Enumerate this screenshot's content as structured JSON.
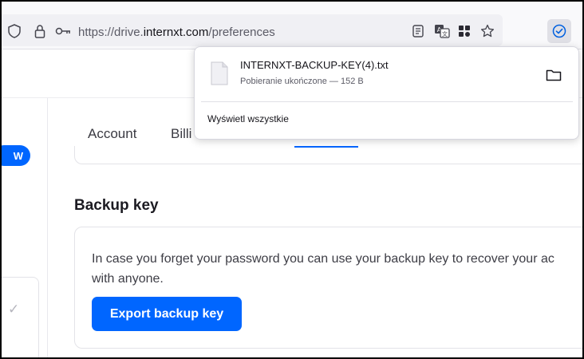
{
  "browser": {
    "url_prefix": "https://drive.",
    "url_domain": "internxt.com",
    "url_path": "/preferences"
  },
  "sidebar": {
    "badge": "W"
  },
  "tabs": [
    {
      "label": "Account"
    },
    {
      "label": "Billi"
    }
  ],
  "backup_section": {
    "title": "Backup key",
    "description_line1": "In case you forget your password you can use your backup key to recover your ac",
    "description_line2": "with anyone.",
    "export_button": "Export backup key"
  },
  "downloads_panel": {
    "filename": "INTERNXT-BACKUP-KEY(4).txt",
    "status": "Pobieranie ukończone — 152 B",
    "show_all": "Wyświetl wszystkie"
  },
  "colors": {
    "accent": "#0066ff",
    "toolbar_bg": "#f9f9fb",
    "urlbar_bg": "#f0f0f4"
  },
  "icons": [
    "shield-icon",
    "lock-icon",
    "key-icon",
    "reader-view-icon",
    "translate-icon",
    "extensions-icon",
    "bookmark-star-icon",
    "downloads-icon",
    "file-icon",
    "folder-icon",
    "check-icon"
  ]
}
